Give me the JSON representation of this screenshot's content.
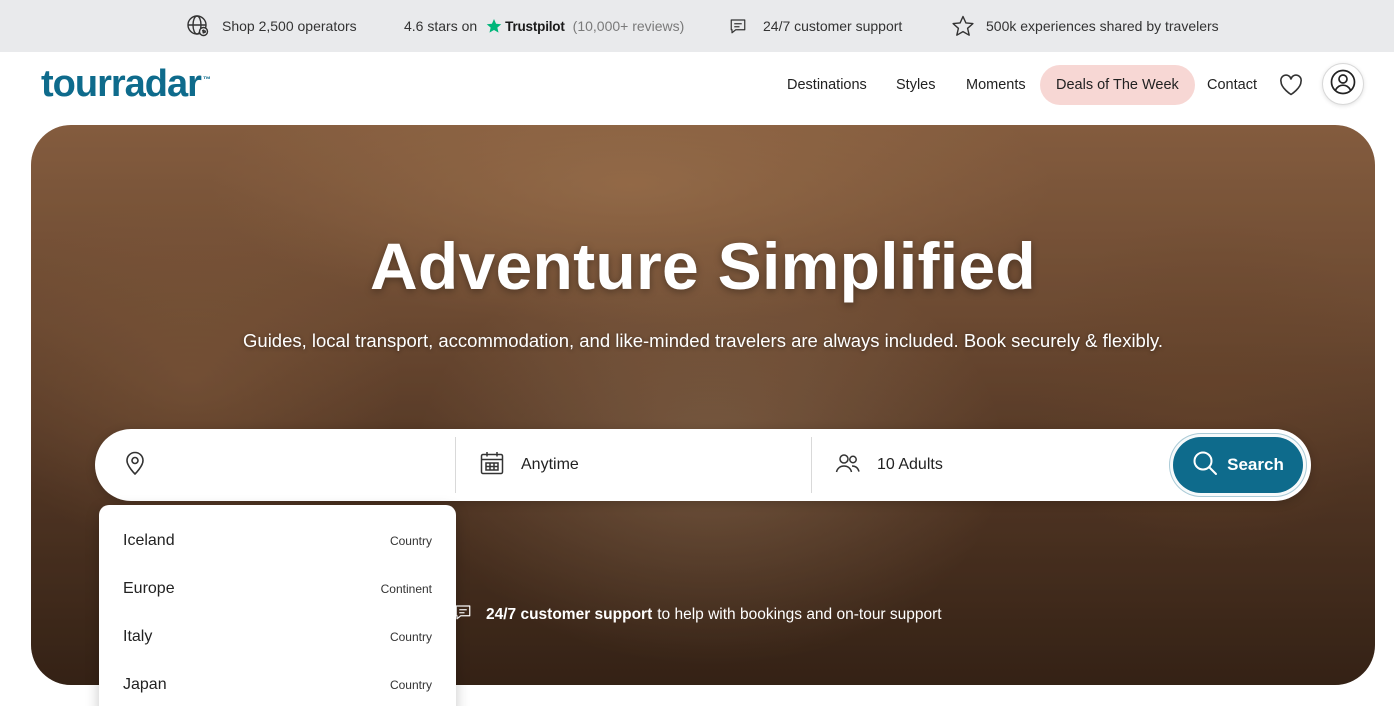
{
  "topbar": {
    "operators": "Shop 2,500 operators",
    "rating_prefix": "4.6 stars on",
    "trustpilot_label": "Trustpilot",
    "reviews": "(10,000+ reviews)",
    "support": "24/7 customer support",
    "experiences": "500k experiences shared by travelers"
  },
  "brand": {
    "logo_text": "tourradar",
    "logo_tm": "™",
    "color": "#0e6b8c"
  },
  "nav": {
    "destinations": "Destinations",
    "styles": "Styles",
    "moments": "Moments",
    "deals": "Deals of The Week",
    "contact": "Contact"
  },
  "hero": {
    "title": "Adventure Simplified",
    "subtitle": "Guides, local transport, accommodation, and like-minded travelers are always included. Book securely & flexibly.",
    "support_bold": "24/7 customer support",
    "support_rest": "to help with bookings and on-tour support"
  },
  "search": {
    "destination_value": "",
    "destination_placeholder": "",
    "date": "Anytime",
    "travelers": "10 Adults",
    "button": "Search"
  },
  "dropdown": {
    "items": [
      {
        "name": "Iceland",
        "type": "Country"
      },
      {
        "name": "Europe",
        "type": "Continent"
      },
      {
        "name": "Italy",
        "type": "Country"
      },
      {
        "name": "Japan",
        "type": "Country"
      }
    ]
  },
  "colors": {
    "accent": "#0e6b8c",
    "deals_bg": "#f7d7d4",
    "trustpilot_green": "#00b67a",
    "topbar_bg": "#e9eaec"
  },
  "icons": {
    "operators": "globe-icon",
    "trustpilot": "star-icon",
    "support": "chat-icon",
    "experiences": "star-outline-icon",
    "wishlist": "heart-icon",
    "account": "user-icon",
    "destination": "map-pin-icon",
    "date": "calendar-icon",
    "travelers": "users-icon",
    "search": "search-icon"
  }
}
